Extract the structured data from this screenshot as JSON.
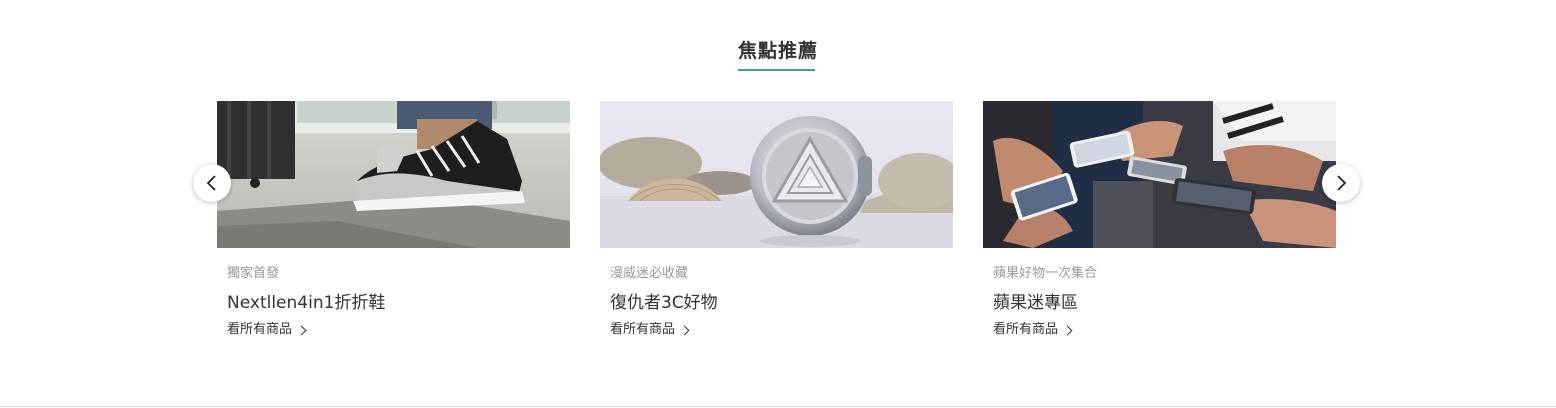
{
  "section": {
    "title": "焦點推薦"
  },
  "colors": {
    "accent_underline": "#3aa29b",
    "title_text": "#333333",
    "subtitle_text": "#999999"
  },
  "carousel": {
    "prev_icon": "chevron-left-icon",
    "next_icon": "chevron-right-icon",
    "cards": [
      {
        "image": "sneaker-photo",
        "subtitle": "獨家首發",
        "title": "Nextllen4in1折折鞋",
        "link_label": "看所有商品"
      },
      {
        "image": "arc-reactor-powerbank-photo",
        "subtitle": "漫威迷必收藏",
        "title": "復仇者3C好物",
        "link_label": "看所有商品"
      },
      {
        "image": "hands-holding-phones-photo",
        "subtitle": "蘋果好物一次集合",
        "title": "蘋果迷專區",
        "link_label": "看所有商品"
      }
    ]
  }
}
